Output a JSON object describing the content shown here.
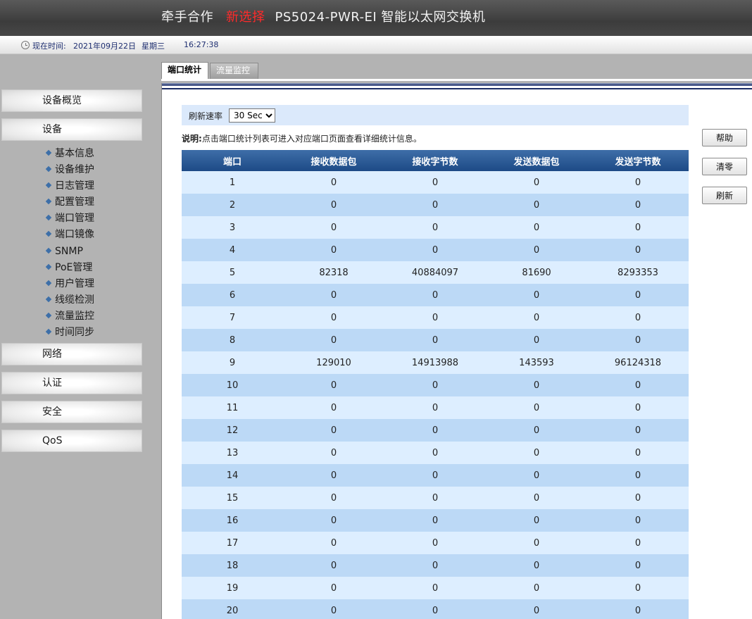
{
  "header": {
    "brand_1": "牵手合作",
    "brand_2": "新选择",
    "brand_3": "PS5024-PWR-EI 智能以太网交换机"
  },
  "status": {
    "label": "现在时间:",
    "date": "2021年09月22日",
    "weekday": "星期三",
    "time": "16:27:38"
  },
  "sidebar": {
    "sections": [
      "设备概览",
      "设备",
      "网络",
      "认证",
      "安全",
      "QoS"
    ],
    "sub_items": [
      "基本信息",
      "设备维护",
      "日志管理",
      "配置管理",
      "端口管理",
      "端口镜像",
      "SNMP",
      "PoE管理",
      "用户管理",
      "线缆检测",
      "流量监控",
      "时间同步"
    ]
  },
  "tabs": [
    "端口统计",
    "流量监控"
  ],
  "refresh": {
    "label": "刷新速率",
    "selected": "30 Sec"
  },
  "note": {
    "bold": "说明:",
    "text": "点击端口统计列表可进入对应端口页面查看详细统计信息。"
  },
  "table": {
    "columns": [
      "端口",
      "接收数据包",
      "接收字节数",
      "发送数据包",
      "发送字节数"
    ],
    "rows": [
      [
        "1",
        "0",
        "0",
        "0",
        "0"
      ],
      [
        "2",
        "0",
        "0",
        "0",
        "0"
      ],
      [
        "3",
        "0",
        "0",
        "0",
        "0"
      ],
      [
        "4",
        "0",
        "0",
        "0",
        "0"
      ],
      [
        "5",
        "82318",
        "40884097",
        "81690",
        "8293353"
      ],
      [
        "6",
        "0",
        "0",
        "0",
        "0"
      ],
      [
        "7",
        "0",
        "0",
        "0",
        "0"
      ],
      [
        "8",
        "0",
        "0",
        "0",
        "0"
      ],
      [
        "9",
        "129010",
        "14913988",
        "143593",
        "96124318"
      ],
      [
        "10",
        "0",
        "0",
        "0",
        "0"
      ],
      [
        "11",
        "0",
        "0",
        "0",
        "0"
      ],
      [
        "12",
        "0",
        "0",
        "0",
        "0"
      ],
      [
        "13",
        "0",
        "0",
        "0",
        "0"
      ],
      [
        "14",
        "0",
        "0",
        "0",
        "0"
      ],
      [
        "15",
        "0",
        "0",
        "0",
        "0"
      ],
      [
        "16",
        "0",
        "0",
        "0",
        "0"
      ],
      [
        "17",
        "0",
        "0",
        "0",
        "0"
      ],
      [
        "18",
        "0",
        "0",
        "0",
        "0"
      ],
      [
        "19",
        "0",
        "0",
        "0",
        "0"
      ],
      [
        "20",
        "0",
        "0",
        "0",
        "0"
      ]
    ]
  },
  "buttons": {
    "help": "帮助",
    "clear": "清零",
    "refresh": "刷新"
  }
}
